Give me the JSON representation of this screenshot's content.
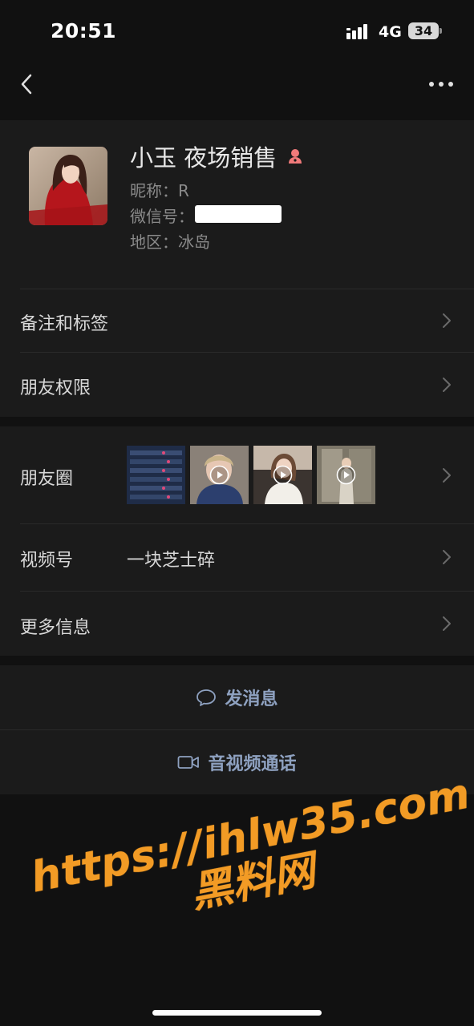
{
  "status_bar": {
    "time": "20:51",
    "network": "4G",
    "battery": "34"
  },
  "profile": {
    "name": "小玉 夜场销售",
    "nickname": "昵称：R",
    "wechat_id_label": "微信号：",
    "region": "地区：冰岛"
  },
  "settings": {
    "remarks": "备注和标签",
    "permissions": "朋友权限"
  },
  "details": {
    "moments": "朋友圈",
    "channels": "视频号",
    "channels_value": "一块芝士碎",
    "more_info": "更多信息"
  },
  "actions": {
    "message": "发消息",
    "call": "音视频通话"
  },
  "watermark": {
    "url": "https://ihlw35.com",
    "name": "黑料网"
  },
  "colors": {
    "background": "#111111",
    "surface": "#1b1b1b",
    "link": "#8ea1c0",
    "watermark": "#f29b25"
  }
}
